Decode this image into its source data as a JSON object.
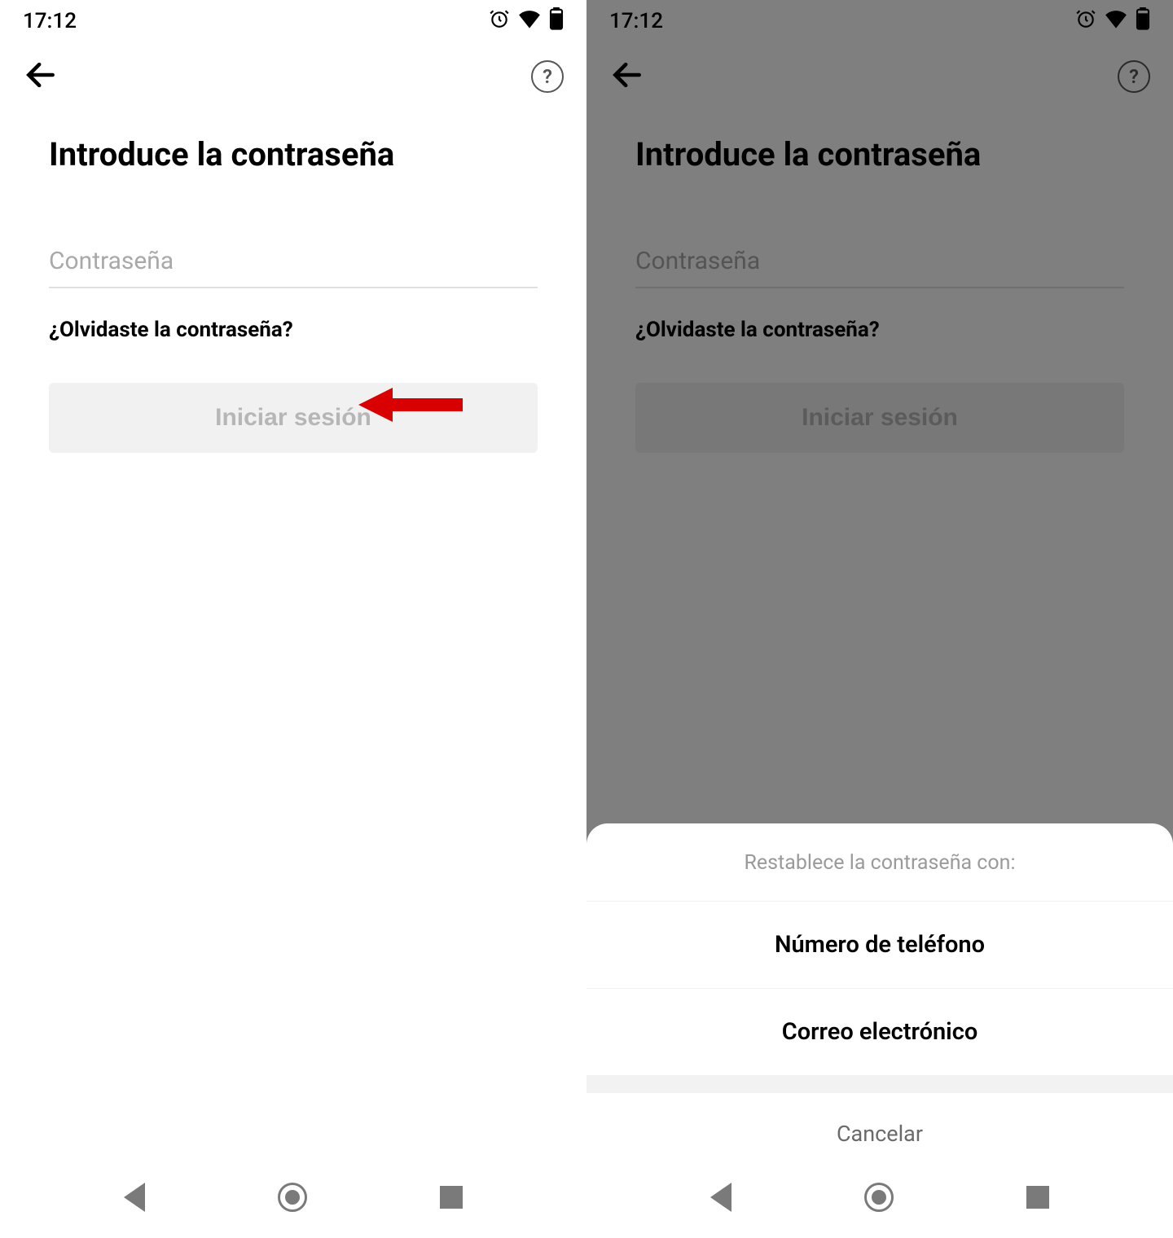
{
  "status": {
    "time": "17:12"
  },
  "screen": {
    "title": "Introduce la contraseña",
    "password_placeholder": "Contraseña",
    "forgot": "¿Olvidaste la contraseña?",
    "login_button": "Iniciar sesión"
  },
  "sheet": {
    "title": "Restablece la contraseña con:",
    "options": [
      {
        "label": "Número de teléfono"
      },
      {
        "label": "Correo electrónico"
      }
    ],
    "cancel": "Cancelar"
  }
}
